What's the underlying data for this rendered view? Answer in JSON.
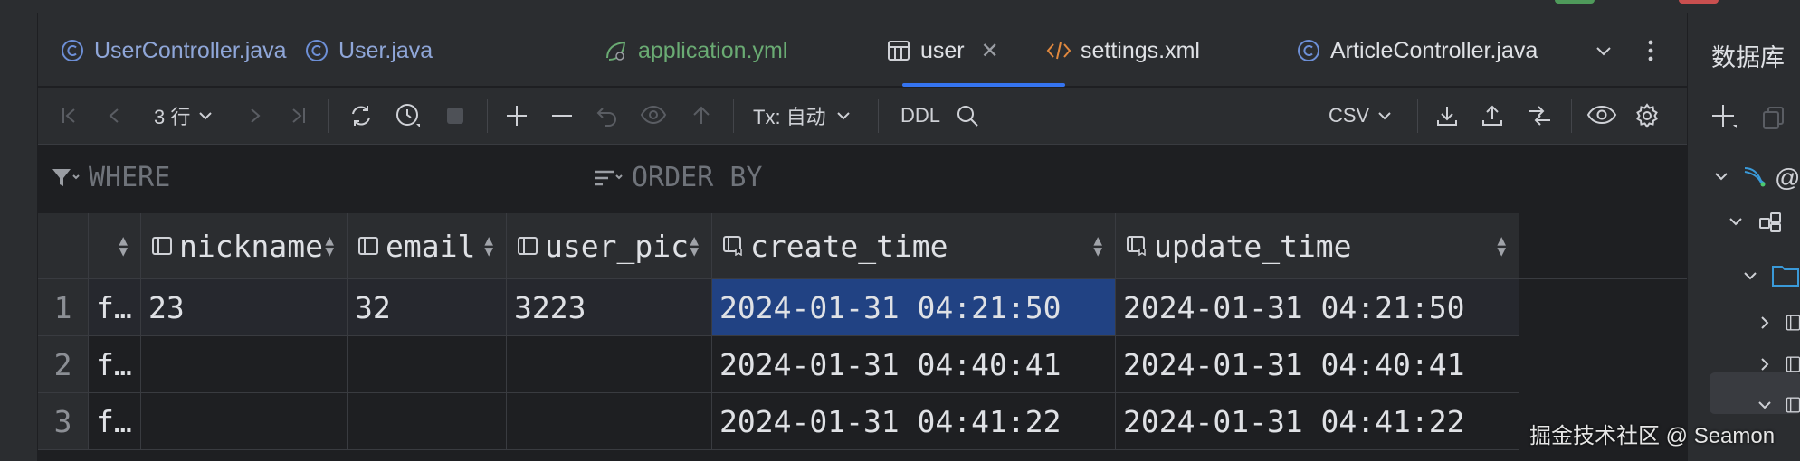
{
  "tabs": [
    {
      "label": "UserController.java",
      "icon": "class-c-icon"
    },
    {
      "label": "User.java",
      "icon": "class-c-icon"
    },
    {
      "label": "application.yml",
      "icon": "spring-leaf-icon"
    },
    {
      "label": "user",
      "icon": "table-grid-icon",
      "active": true
    },
    {
      "label": "settings.xml",
      "icon": "xml-code-icon"
    },
    {
      "label": "ArticleController.java",
      "icon": "class-c-icon"
    }
  ],
  "toolbar": {
    "rows_label": "3 行",
    "tx_label": "Tx: 自动",
    "ddl_label": "DDL",
    "csv_label": "CSV"
  },
  "filters": {
    "where_label": "WHERE",
    "order_label": "ORDER BY"
  },
  "grid": {
    "columns": [
      "",
      "nickname",
      "email",
      "user_pic",
      "create_time",
      "update_time"
    ],
    "rows": [
      {
        "num": "1",
        "c0": "f…",
        "nickname": "23",
        "email": "32",
        "user_pic": "3223",
        "create_time": "2024-01-31 04:21:50",
        "update_time": "2024-01-31 04:21:50"
      },
      {
        "num": "2",
        "c0": "f…",
        "nickname": "",
        "email": "",
        "user_pic": "",
        "create_time": "2024-01-31 04:40:41",
        "update_time": "2024-01-31 04:40:41"
      },
      {
        "num": "3",
        "c0": "f…",
        "nickname": "",
        "email": "",
        "user_pic": "",
        "create_time": "2024-01-31 04:41:22",
        "update_time": "2024-01-31 04:41:22"
      }
    ]
  },
  "right_panel": {
    "title": "数据库"
  },
  "watermark": "掘金技术社区 @ Seamon",
  "colors": {
    "accent": "#3574f0",
    "selection": "#214283",
    "background": "#1e1f22",
    "panel": "#2b2d30"
  }
}
